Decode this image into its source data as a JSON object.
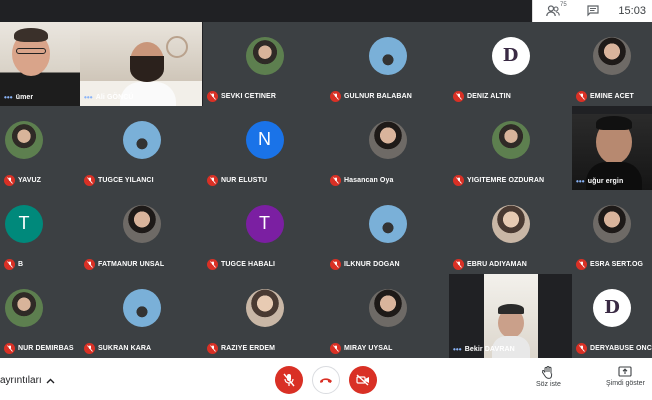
{
  "header": {
    "participant_count": "75",
    "time": "15:03"
  },
  "tiles": [
    {
      "name": "ümer",
      "kind": "video"
    },
    {
      "name": "Ali GÖNCÜ",
      "kind": "video"
    },
    {
      "name": "SEVKI CETINER",
      "kind": "photo"
    },
    {
      "name": "GULNUR BALABAN",
      "kind": "photo"
    },
    {
      "name": "DENIZ ALTIN",
      "kind": "logo",
      "letter": "D"
    },
    {
      "name": "EMINE ACET",
      "kind": "photo"
    },
    {
      "name": "YAVUZ",
      "kind": "photo"
    },
    {
      "name": "TUGCE YILANCI",
      "kind": "photo"
    },
    {
      "name": "NUR ELUSTU",
      "kind": "letter",
      "letter": "N",
      "color": "#1a73e8"
    },
    {
      "name": "Hasancan Oya",
      "kind": "photo"
    },
    {
      "name": "YIGITEMRE OZDURAN",
      "kind": "photo"
    },
    {
      "name": "uğur ergin",
      "kind": "video"
    },
    {
      "name": "B",
      "kind": "letter",
      "letter": "T",
      "color": "#00897b"
    },
    {
      "name": "FATMANUR UNSAL",
      "kind": "photo"
    },
    {
      "name": "TUGCE HABALI",
      "kind": "letter",
      "letter": "T",
      "color": "#7b1fa2"
    },
    {
      "name": "ILKNUR DOGAN",
      "kind": "photo"
    },
    {
      "name": "EBRU ADIYAMAN",
      "kind": "photo"
    },
    {
      "name": "ESRA SERT.OG",
      "kind": "photo"
    },
    {
      "name": "NUR DEMIRBAS",
      "kind": "photo"
    },
    {
      "name": "SUKRAN KARA",
      "kind": "photo"
    },
    {
      "name": "RAZIYE ERDEM",
      "kind": "photo"
    },
    {
      "name": "MIRAY UYSAL",
      "kind": "photo"
    },
    {
      "name": "Bekir DAVRAN",
      "kind": "video"
    },
    {
      "name": "DERYABUSE ONCE",
      "kind": "logo",
      "letter": "D"
    }
  ],
  "bottom": {
    "meeting_details": "ayrıntıları",
    "raise_hand": "Söz iste",
    "present_now": "Şimdi göster"
  },
  "colors": {
    "mute_red": "#d93025",
    "tile_bg": "#3c4043",
    "bg": "#202124"
  }
}
